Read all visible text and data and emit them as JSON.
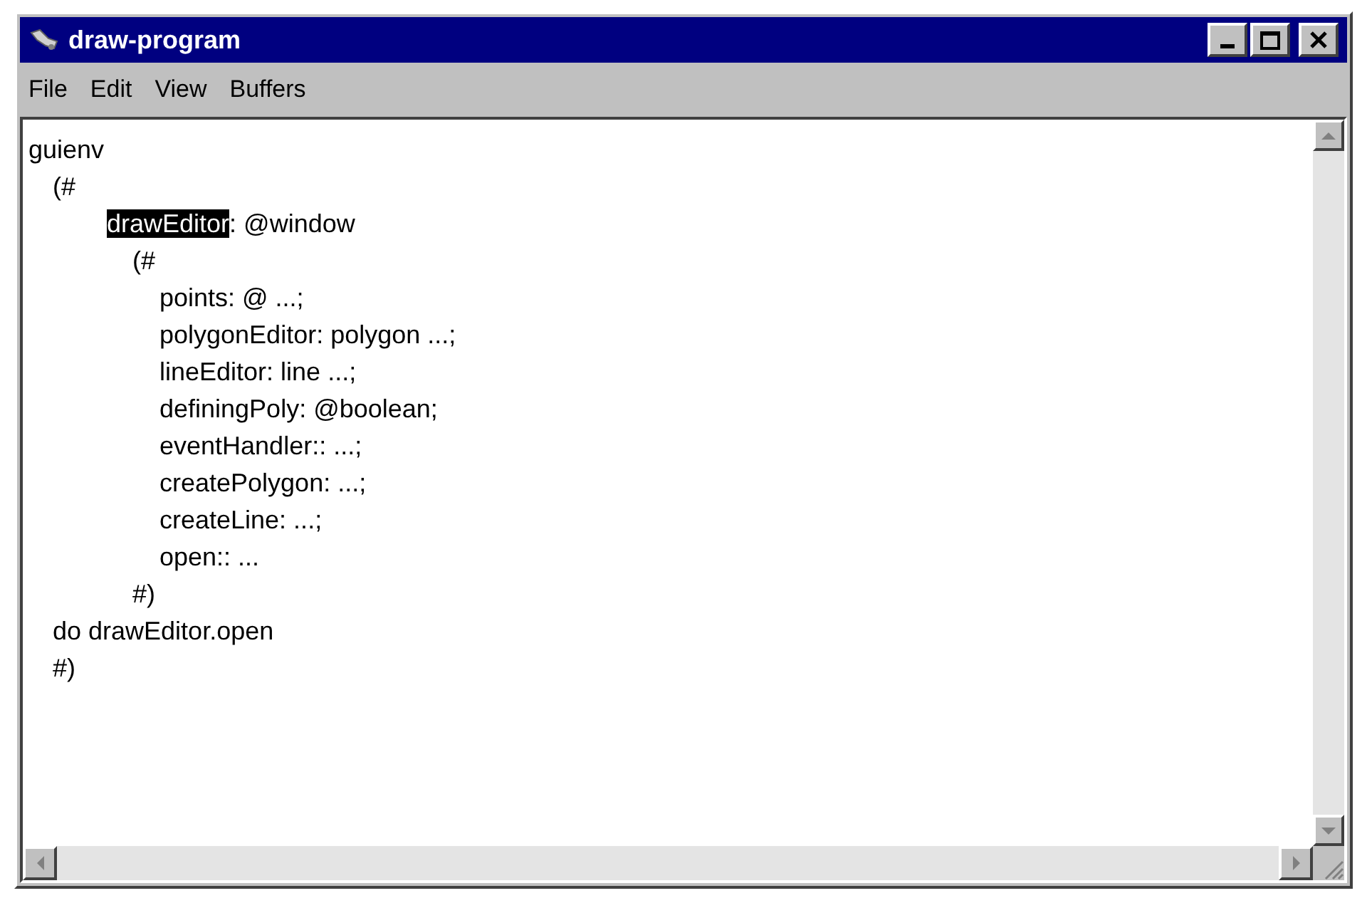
{
  "window": {
    "title": "draw-program"
  },
  "menu": [
    "File",
    "Edit",
    "View",
    "Buffers"
  ],
  "editor": {
    "lines": [
      {
        "segments": [
          {
            "text": "guienv",
            "selected": false
          }
        ],
        "children": [
          {
            "segments": [
              {
                "text": "(#",
                "selected": false
              }
            ],
            "children": [
              {
                "segments": [
                  {
                    "text": "drawEditor",
                    "selected": true
                  },
                  {
                    "text": ": @window",
                    "selected": false
                  }
                ],
                "children": [
                  {
                    "segments": [
                      {
                        "text": "(#",
                        "selected": false
                      }
                    ],
                    "children": [
                      {
                        "segments": [
                          {
                            "text": "points: @ ...;",
                            "selected": false
                          }
                        ]
                      },
                      {
                        "segments": [
                          {
                            "text": "polygonEditor: polygon ...;",
                            "selected": false
                          }
                        ]
                      },
                      {
                        "segments": [
                          {
                            "text": "lineEditor: line ...;",
                            "selected": false
                          }
                        ]
                      },
                      {
                        "segments": [
                          {
                            "text": "definingPoly: @boolean;",
                            "selected": false
                          }
                        ]
                      },
                      {
                        "segments": [
                          {
                            "text": "eventHandler:: ...;",
                            "selected": false
                          }
                        ]
                      },
                      {
                        "segments": [
                          {
                            "text": "createPolygon: ...;",
                            "selected": false
                          }
                        ]
                      },
                      {
                        "segments": [
                          {
                            "text": "createLine: ...;",
                            "selected": false
                          }
                        ]
                      },
                      {
                        "segments": [
                          {
                            "text": "open:: ...",
                            "selected": false
                          }
                        ]
                      }
                    ]
                  },
                  {
                    "segments": [
                      {
                        "text": "#)",
                        "selected": false
                      }
                    ]
                  }
                ]
              }
            ]
          },
          {
            "segments": [
              {
                "text": "do drawEditor.open",
                "selected": false
              }
            ]
          },
          {
            "segments": [
              {
                "text": "#)",
                "selected": false
              }
            ]
          }
        ]
      }
    ]
  }
}
